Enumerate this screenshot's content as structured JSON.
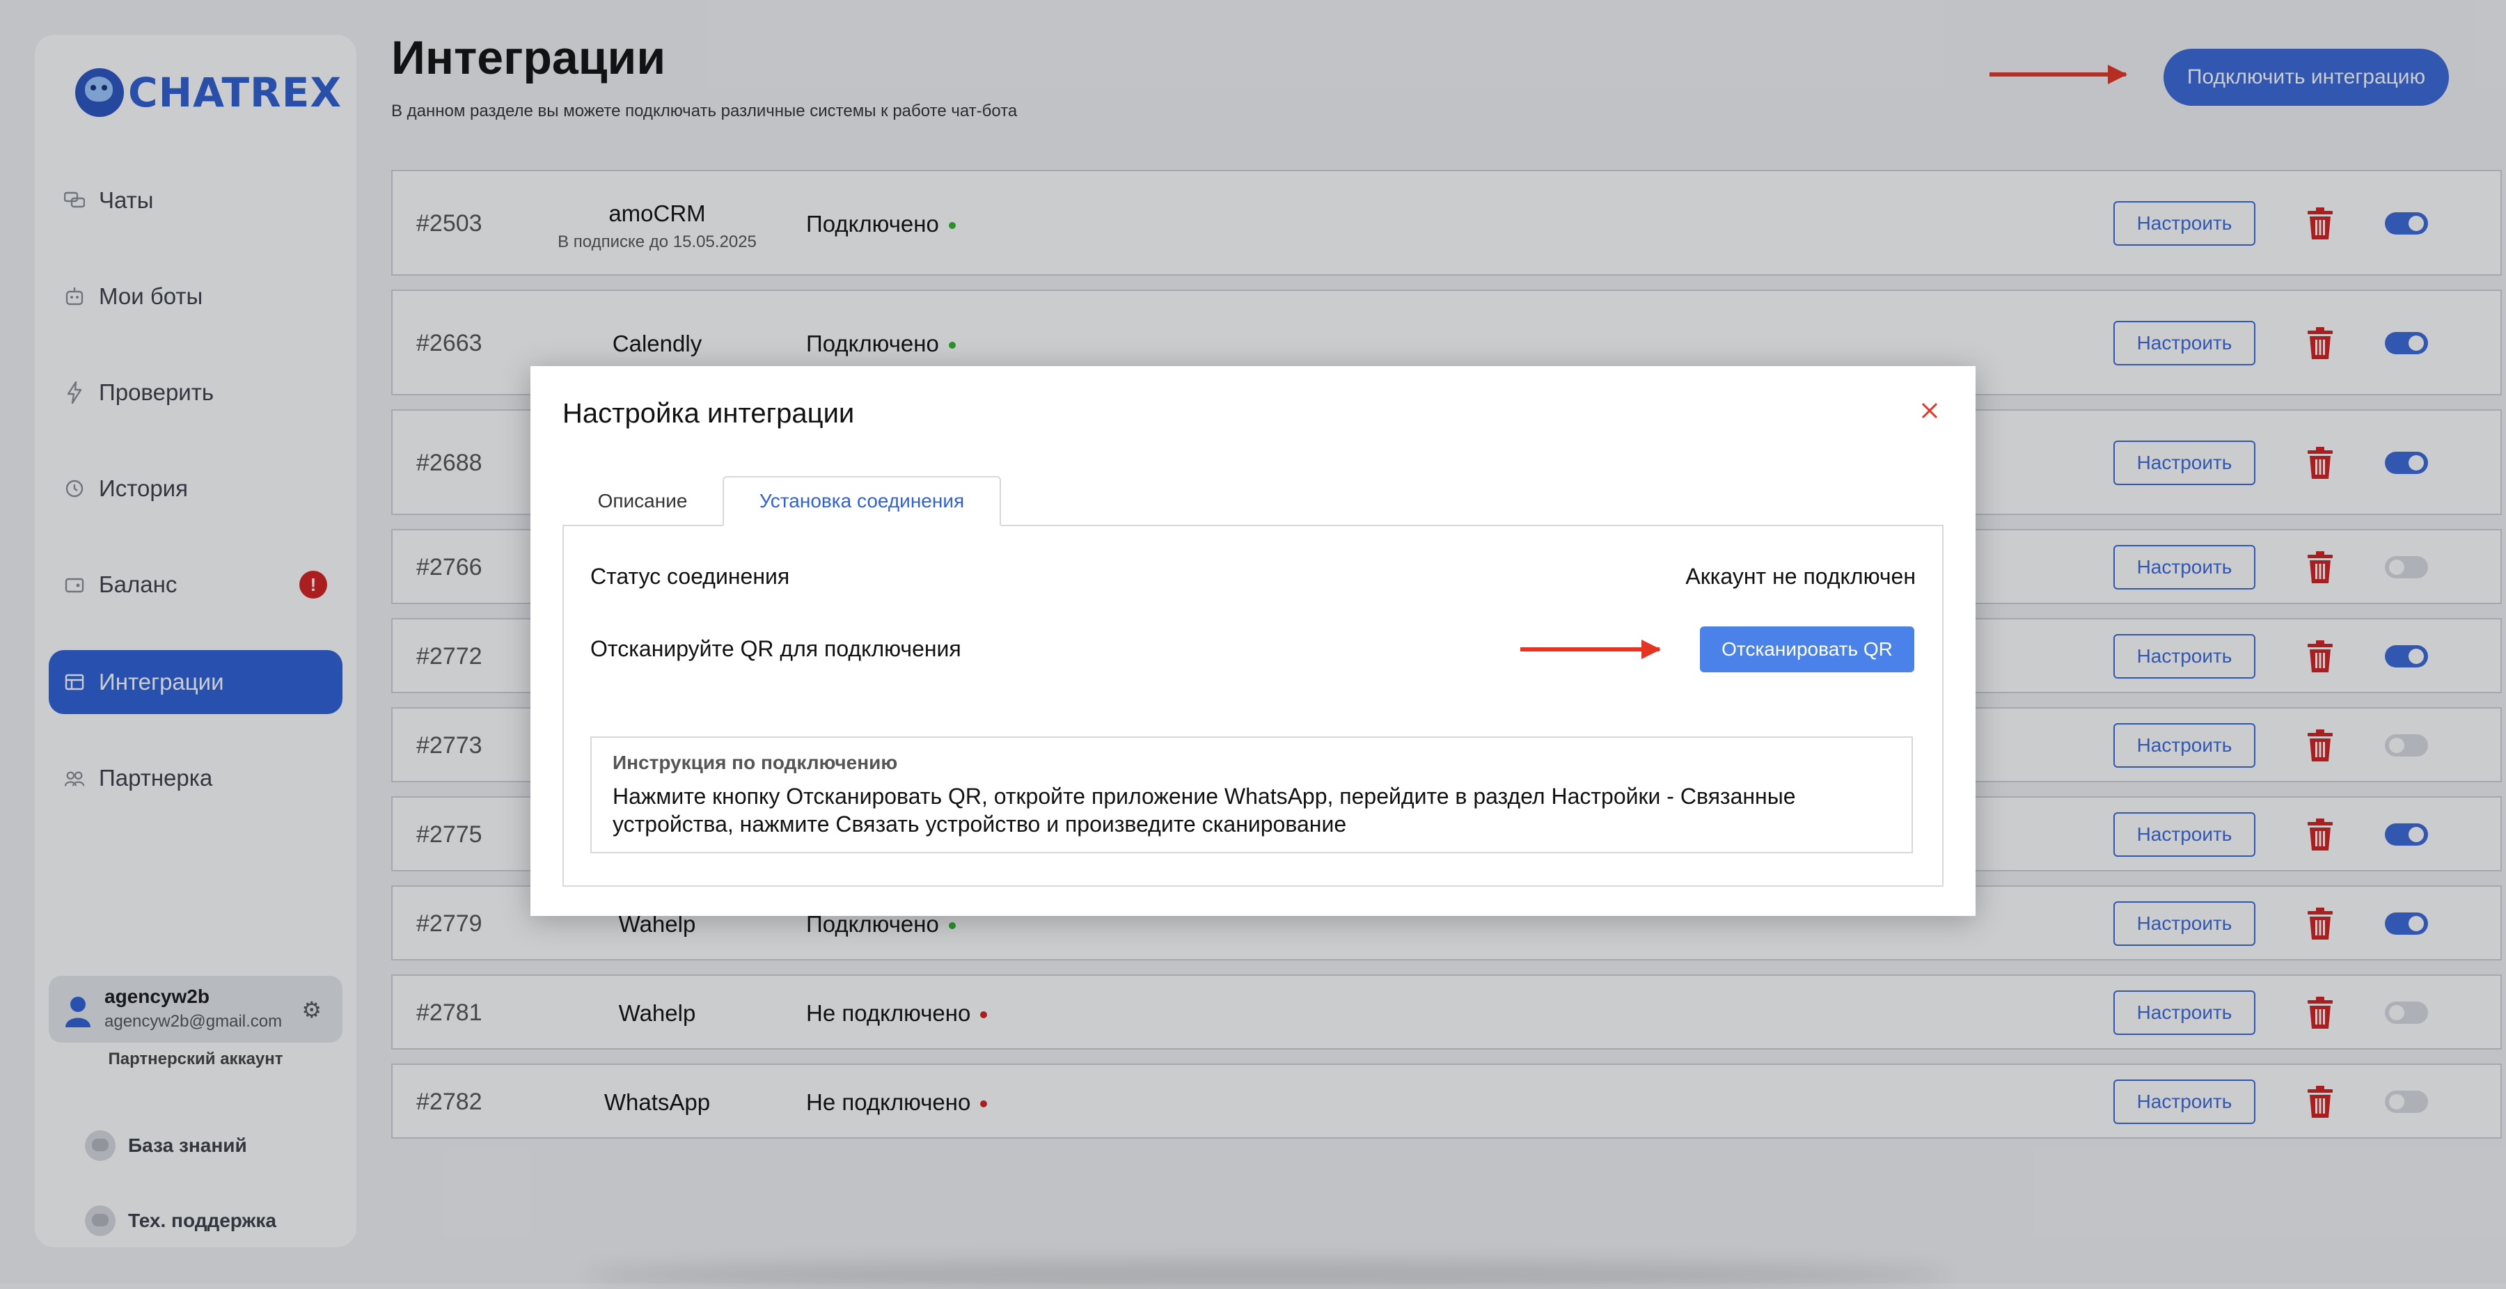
{
  "sidebar": {
    "logo_text": "CHATREX",
    "items": [
      {
        "label": "Чаты",
        "icon": "chat-icon"
      },
      {
        "label": "Мои боты",
        "icon": "bot-icon"
      },
      {
        "label": "Проверить",
        "icon": "lightning-icon"
      },
      {
        "label": "История",
        "icon": "history-icon"
      },
      {
        "label": "Баланс",
        "icon": "wallet-icon",
        "badge": "!"
      },
      {
        "label": "Интеграции",
        "icon": "integrations-icon",
        "active": true
      },
      {
        "label": "Партнерка",
        "icon": "partners-icon"
      }
    ],
    "user": {
      "name": "agencyw2b",
      "email": "agencyw2b@gmail.com",
      "account_type": "Партнерский аккаунт"
    },
    "bottom_links": [
      {
        "label": "База знаний"
      },
      {
        "label": "Тех. поддержка"
      }
    ]
  },
  "header": {
    "title": "Интеграции",
    "subtitle": "В данном разделе вы можете подключать различные системы к работе чат-бота",
    "connect_button": "Подключить интеграцию"
  },
  "integrations": {
    "configure_label": "Настроить",
    "rows": [
      {
        "id": "#2503",
        "name": "amoCRM",
        "sub": "В подписке до 15.05.2025",
        "status": "Подключено",
        "ok": true,
        "enabled": true
      },
      {
        "id": "#2663",
        "name": "Calendly",
        "sub": "",
        "status": "Подключено",
        "ok": true,
        "enabled": true
      },
      {
        "id": "#2688",
        "name": "",
        "sub": "",
        "status": "",
        "ok": true,
        "enabled": true
      },
      {
        "id": "#2766",
        "name": "",
        "sub": "",
        "status": "",
        "ok": false,
        "enabled": false
      },
      {
        "id": "#2772",
        "name": "",
        "sub": "",
        "status": "",
        "ok": true,
        "enabled": true
      },
      {
        "id": "#2773",
        "name": "",
        "sub": "",
        "status": "",
        "ok": false,
        "enabled": false
      },
      {
        "id": "#2775",
        "name": "",
        "sub": "",
        "status": "",
        "ok": true,
        "enabled": true
      },
      {
        "id": "#2779",
        "name": "Wahelp",
        "sub": "",
        "status": "Подключено",
        "ok": true,
        "enabled": true
      },
      {
        "id": "#2781",
        "name": "Wahelp",
        "sub": "",
        "status": "Не подключено",
        "ok": false,
        "enabled": false
      },
      {
        "id": "#2782",
        "name": "WhatsApp",
        "sub": "",
        "status": "Не подключено",
        "ok": false,
        "enabled": false
      }
    ]
  },
  "modal": {
    "title": "Настройка интеграции",
    "tabs": [
      {
        "label": "Описание",
        "active": false
      },
      {
        "label": "Установка соединения",
        "active": true
      }
    ],
    "connection_status_label": "Статус соединения",
    "connection_status_value": "Аккаунт не подключен",
    "scan_label": "Отсканируйте QR для подключения",
    "scan_button": "Отсканировать QR",
    "instruction_title": "Инструкция по подключению",
    "instruction_text": "Нажмите кнопку Отсканировать QR, откройте приложение WhatsApp, перейдите в раздел Настройки - Связанные устройства, нажмите Связать устройство и произведите сканирование"
  },
  "colors": {
    "accent": "#3a6ad9",
    "danger": "#d62020",
    "success": "#2fb52f",
    "annotation_arrow": "#e53522"
  }
}
